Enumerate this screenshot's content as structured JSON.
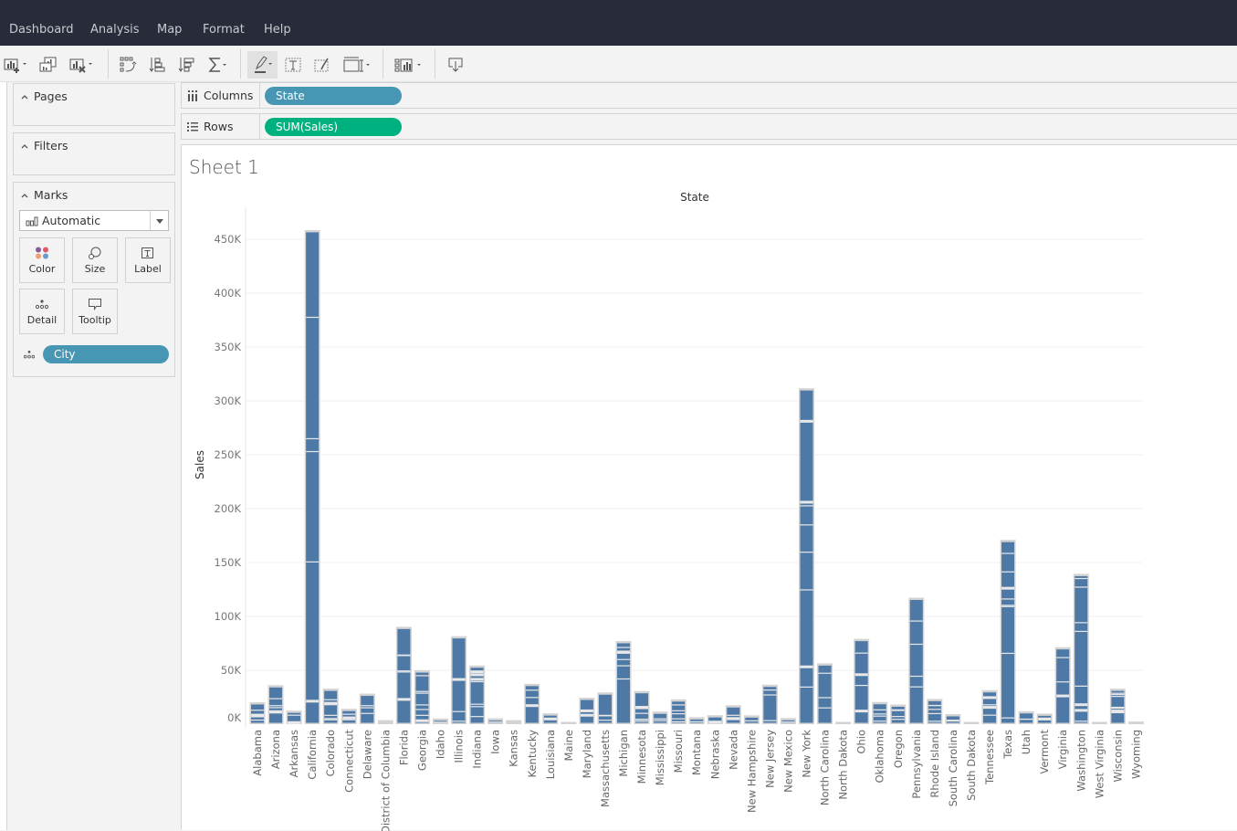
{
  "menu": {
    "items": [
      "Dashboard",
      "Analysis",
      "Map",
      "Format",
      "Help"
    ]
  },
  "toolbar": {
    "icons": [
      "new-worksheet-icon",
      "duplicate-sheet-icon",
      "clear-sheet-icon",
      "swap-rows-columns-icon",
      "sort-ascending-icon",
      "sort-descending-icon",
      "totals-sigma-icon",
      "highlight-icon",
      "text-label-icon",
      "annotate-icon",
      "fit-icon",
      "show-me-icon",
      "download-icon"
    ]
  },
  "panes": {
    "pages_label": "Pages",
    "filters_label": "Filters",
    "marks_label": "Marks",
    "mark_type": "Automatic",
    "mark_buttons": [
      "Color",
      "Size",
      "Label",
      "Detail",
      "Tooltip"
    ],
    "detail_pill": "City"
  },
  "shelves": {
    "columns_label": "Columns",
    "columns_pill": "State",
    "rows_label": "Rows",
    "rows_pill": "SUM(Sales)"
  },
  "colors": {
    "dimension_pill": "#4696b4",
    "measure_pill": "#00b180",
    "bar": "#4e79a7",
    "bar_gap": "#d3d3d3",
    "menubar": "#272b3a"
  },
  "sheet": {
    "title": "Sheet 1"
  },
  "chart_data": {
    "type": "bar",
    "stacked_by": "City",
    "title": "State",
    "xlabel": "State",
    "ylabel": "Sales",
    "ylim": [
      0,
      460000
    ],
    "yticks": [
      0,
      50000,
      100000,
      150000,
      200000,
      250000,
      300000,
      350000,
      400000,
      450000
    ],
    "ytick_labels": [
      "0K",
      "50K",
      "100K",
      "150K",
      "200K",
      "250K",
      "300K",
      "350K",
      "400K",
      "450K"
    ],
    "grid": true,
    "categories": [
      "Alabama",
      "Arizona",
      "Arkansas",
      "California",
      "Colorado",
      "Connecticut",
      "Delaware",
      "District of Columbia",
      "Florida",
      "Georgia",
      "Idaho",
      "Illinois",
      "Indiana",
      "Iowa",
      "Kansas",
      "Kentucky",
      "Louisiana",
      "Maine",
      "Maryland",
      "Massachusetts",
      "Michigan",
      "Minnesota",
      "Mississippi",
      "Missouri",
      "Montana",
      "Nebraska",
      "Nevada",
      "New Hampshire",
      "New Jersey",
      "New Mexico",
      "New York",
      "North Carolina",
      "North Dakota",
      "Ohio",
      "Oklahoma",
      "Oregon",
      "Pennsylvania",
      "Rhode Island",
      "South Carolina",
      "South Dakota",
      "Tennessee",
      "Texas",
      "Utah",
      "Vermont",
      "Virginia",
      "Washington",
      "West Virginia",
      "Wisconsin",
      "Wyoming"
    ],
    "values": [
      19500,
      35300,
      11700,
      457700,
      32100,
      13400,
      27500,
      2900,
      89500,
      49100,
      4400,
      80800,
      53600,
      4600,
      2900,
      36600,
      9200,
      1300,
      23700,
      28600,
      76300,
      29900,
      10800,
      22200,
      5600,
      7500,
      16700,
      7300,
      35800,
      4800,
      310900,
      55600,
      900,
      78300,
      19700,
      17400,
      116500,
      22600,
      8500,
      1300,
      30700,
      170200,
      11200,
      9000,
      70600,
      138600,
      1200,
      32100,
      1600
    ]
  }
}
